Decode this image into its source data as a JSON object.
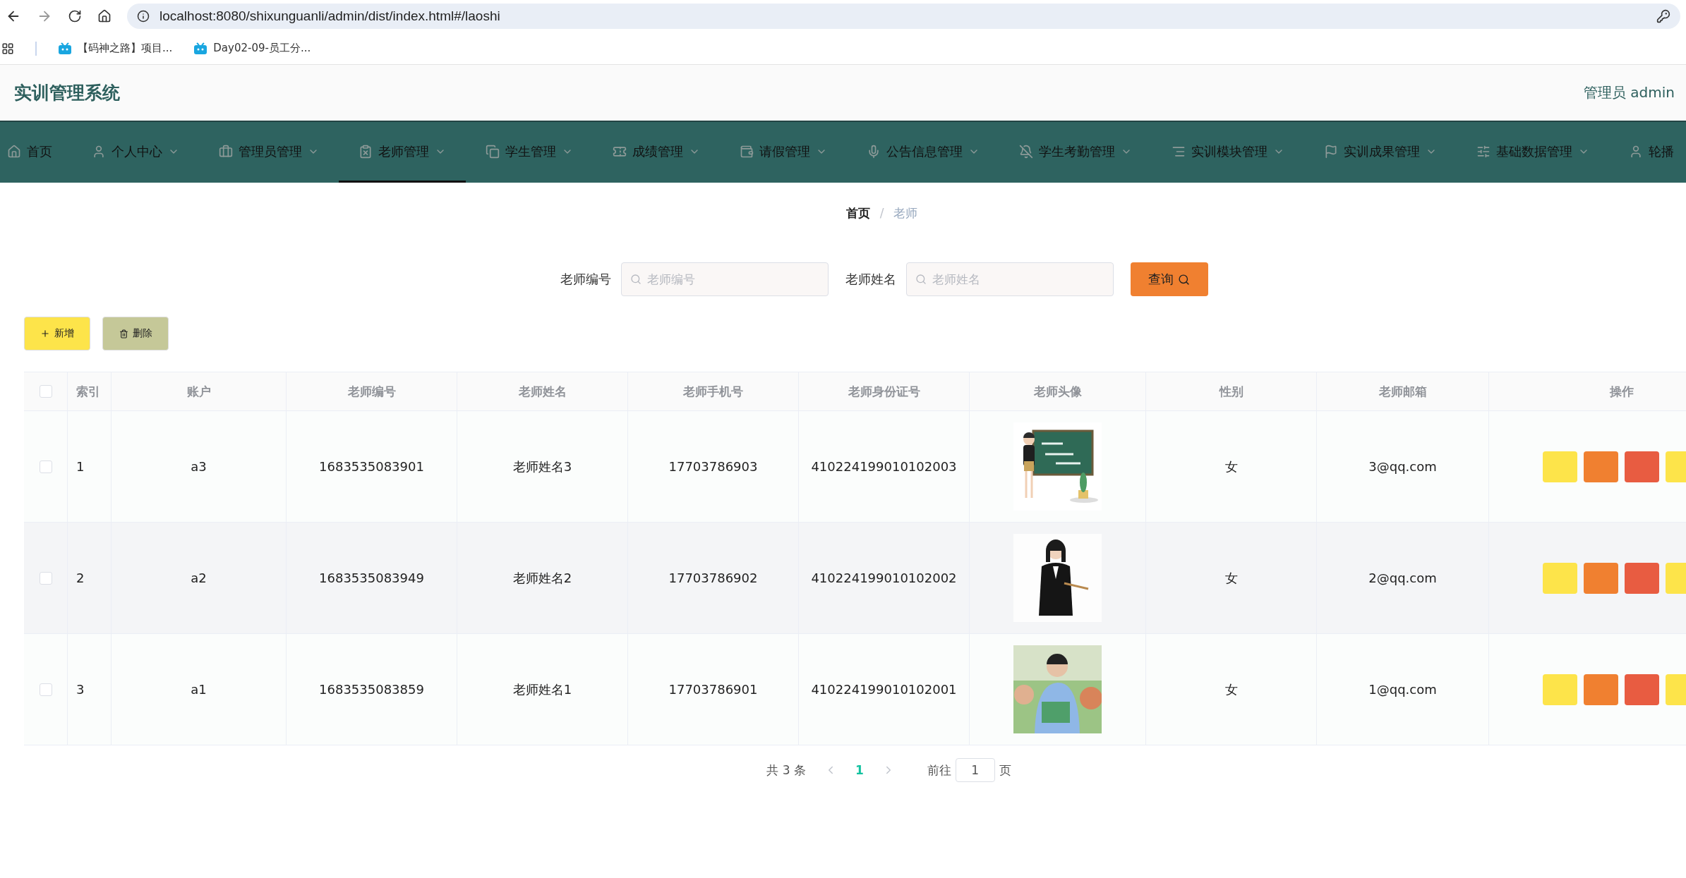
{
  "browser": {
    "url": "localhost:8080/shixunguanli/admin/dist/index.html#/laoshi",
    "bookmarks": [
      "【码神之路】项目...",
      "Day02-09-员工分..."
    ]
  },
  "header": {
    "title": "实训管理系统",
    "user": "管理员 admin"
  },
  "nav": [
    {
      "label": "首页",
      "caret": false,
      "selected": false
    },
    {
      "label": "个人中心",
      "caret": true,
      "selected": false
    },
    {
      "label": "管理员管理",
      "caret": true,
      "selected": false
    },
    {
      "label": "老师管理",
      "caret": true,
      "selected": true
    },
    {
      "label": "学生管理",
      "caret": true,
      "selected": false
    },
    {
      "label": "成绩管理",
      "caret": true,
      "selected": false
    },
    {
      "label": "请假管理",
      "caret": true,
      "selected": false
    },
    {
      "label": "公告信息管理",
      "caret": true,
      "selected": false
    },
    {
      "label": "学生考勤管理",
      "caret": true,
      "selected": false
    },
    {
      "label": "实训模块管理",
      "caret": true,
      "selected": false
    },
    {
      "label": "实训成果管理",
      "caret": true,
      "selected": false
    },
    {
      "label": "基础数据管理",
      "caret": true,
      "selected": false
    },
    {
      "label": "轮播",
      "caret": false,
      "selected": false
    }
  ],
  "breadcrumb": {
    "separator": "/",
    "items": [
      {
        "label": "首页",
        "current": false
      },
      {
        "label": "老师",
        "current": true
      }
    ]
  },
  "search": {
    "fields": [
      {
        "label": "老师编号",
        "placeholder": "老师编号"
      },
      {
        "label": "老师姓名",
        "placeholder": "老师姓名"
      }
    ],
    "button": "查询"
  },
  "actions": [
    {
      "kind": "add",
      "label": "新增"
    },
    {
      "kind": "delete",
      "label": "删除"
    }
  ],
  "table": {
    "all_checked": false,
    "columns": [
      "索引",
      "账户",
      "老师编号",
      "老师姓名",
      "老师手机号",
      "老师身份证号",
      "老师头像",
      "性别",
      "老师邮箱",
      "操作"
    ],
    "row_actions": [
      {
        "color": "#fde44a"
      },
      {
        "color": "#f08030"
      },
      {
        "color": "#e85c41"
      },
      {
        "color": "#fde44a"
      }
    ],
    "rows": [
      {
        "checked": false,
        "index": "1",
        "account": "a3",
        "number": "1683535083901",
        "name": "老师姓名3",
        "phone": "17703786903",
        "id_card": "410224199010102003",
        "gender": "女",
        "email": "3@qq.com"
      },
      {
        "checked": false,
        "index": "2",
        "account": "a2",
        "number": "1683535083949",
        "name": "老师姓名2",
        "phone": "17703786902",
        "id_card": "410224199010102002",
        "gender": "女",
        "email": "2@qq.com"
      },
      {
        "checked": false,
        "index": "3",
        "account": "a1",
        "number": "1683535083859",
        "name": "老师姓名1",
        "phone": "17703786901",
        "id_card": "410224199010102001",
        "gender": "女",
        "email": "1@qq.com"
      }
    ]
  },
  "pagination": {
    "total": "共 3 条",
    "pages": [
      {
        "label": "1",
        "selected": true
      }
    ],
    "goto_label": "前往",
    "goto_value": "1",
    "suffix": "页"
  }
}
